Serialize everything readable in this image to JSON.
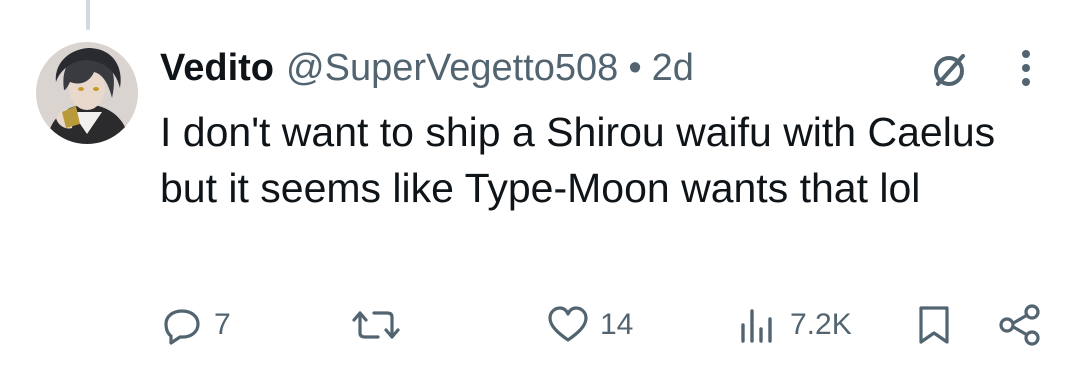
{
  "tweet": {
    "display_name": "Vedito",
    "handle": "@SuperVegetto508",
    "separator": "•",
    "time": "2d",
    "text": "I don't want to ship a Shirou waifu with Caelus but it seems like Type-Moon wants that lol"
  },
  "actions": {
    "replies": "7",
    "reposts": "",
    "likes": "14",
    "views": "7.2K"
  },
  "icons": {
    "header": [
      "grok-icon",
      "more-icon"
    ],
    "actions": [
      "reply-icon",
      "repost-icon",
      "like-icon",
      "views-icon",
      "bookmark-icon",
      "share-icon"
    ]
  },
  "colors": {
    "text": "#0f1419",
    "muted": "#536471",
    "thread_line": "#cfd9de"
  }
}
